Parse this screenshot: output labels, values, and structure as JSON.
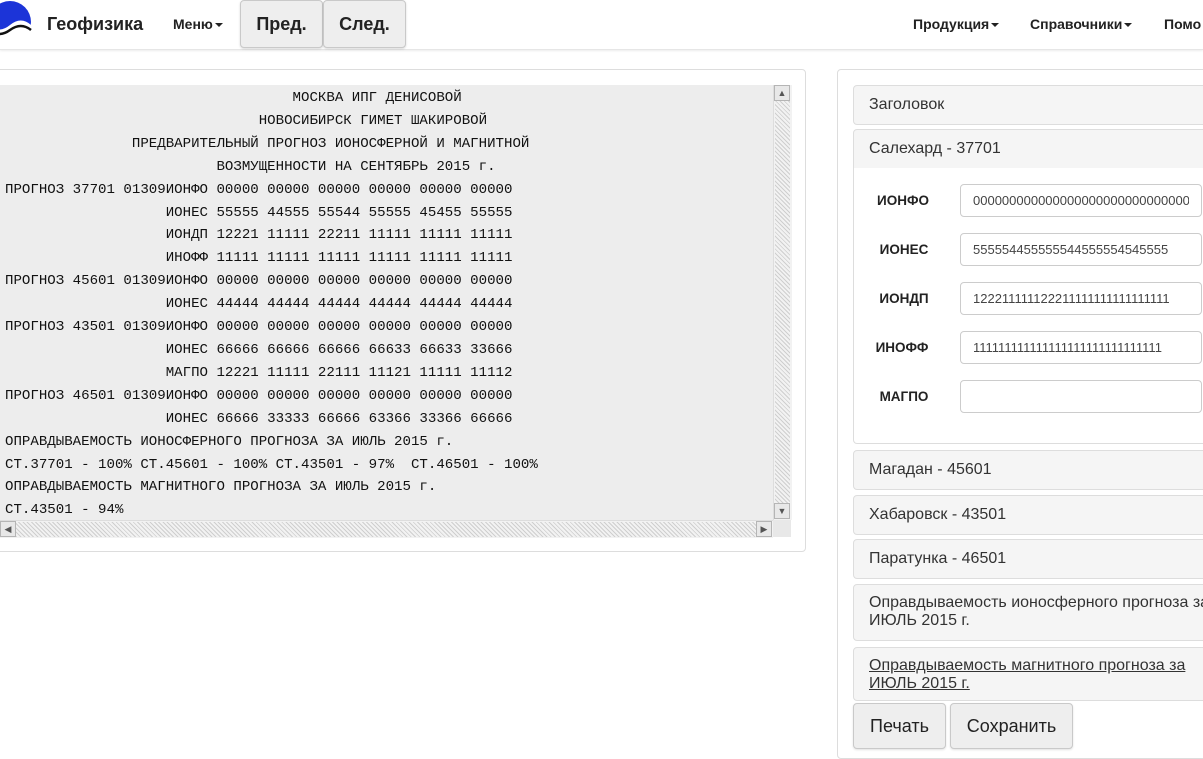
{
  "navbar": {
    "brand": "Геофизика",
    "menu_label": "Меню",
    "prev_label": "Пред.",
    "next_label": "След.",
    "products_label": "Продукция",
    "references_label": "Справочники",
    "help_label": "Помо"
  },
  "forecast": {
    "lines": [
      "                                  МОСКВА ИПГ ДЕНИСОВОЙ",
      "                              НОВОСИБИРСК ГИМЕТ ШАКИРОВОЙ",
      "               ПРЕДВАРИТЕЛЬНЫЙ ПРОГНОЗ ИОНОСФЕРНОЙ И МАГНИТНОЙ",
      "                         ВОЗМУЩЕННОСТИ НА СЕНТЯБРЬ 2015 г.",
      "ПРОГНОЗ 37701 01309ИОНФО 00000 00000 00000 00000 00000 00000",
      "                   ИОНЕС 55555 44555 55544 55555 45455 55555",
      "                   ИОНДП 12221 11111 22211 11111 11111 11111",
      "                   ИНОФФ 11111 11111 11111 11111 11111 11111",
      "ПРОГНОЗ 45601 01309ИОНФО 00000 00000 00000 00000 00000 00000",
      "                   ИОНЕС 44444 44444 44444 44444 44444 44444",
      "ПРОГНОЗ 43501 01309ИОНФО 00000 00000 00000 00000 00000 00000",
      "                   ИОНЕС 66666 66666 66666 66633 66633 33666",
      "                   МАГПО 12221 11111 22111 11121 11111 11112",
      "ПРОГНОЗ 46501 01309ИОНФО 00000 00000 00000 00000 00000 00000",
      "                   ИОНЕС 66666 33333 66666 63366 33366 66666",
      "ОПРАВДЫВАЕМОСТЬ ИОНОСФЕРНОГО ПРОГНОЗА ЗА ИЮЛЬ 2015 г.",
      "СТ.37701 - 100% СТ.45601 - 100% СТ.43501 - 97%  СТ.46501 - 100%",
      "ОПРАВДЫВАЕМОСТЬ МАГНИТНОГО ПРОГНОЗА ЗА ИЮЛЬ 2015 г.",
      "СТ.43501 - 94%"
    ]
  },
  "accordion": {
    "header": "Заголовок",
    "salekhard": "Салехард - 37701",
    "magadan": "Магадан - 45601",
    "khabarovsk": "Хабаровск - 43501",
    "paratunka": "Паратунка - 46501",
    "iono_acc": "Оправдываемость ионосферного прогноза за ИЮЛЬ 2015 г.",
    "mag_acc": "Оправдываемость магнитного прогноза за ИЮЛЬ 2015 г."
  },
  "fields": {
    "ionfo_label": "ИОНФО",
    "ionfo_value": "000000000000000000000000000000",
    "iones_label": "ИОНЕС",
    "iones_value": "555554455555544555554545555",
    "iondp_label": "ИОНДП",
    "iondp_value": "122211111122211111111111111111",
    "inoff_label": "ИНОФФ",
    "inoff_value": "111111111111111111111111111111",
    "magpo_label": "МАГПО",
    "magpo_value": ""
  },
  "actions": {
    "print_label": "Печать",
    "save_label": "Сохранить"
  },
  "colors": {
    "logo_blue": "#1c34d8",
    "text_bg": "#ededed",
    "panel_header_bg": "#f5f5f5"
  }
}
